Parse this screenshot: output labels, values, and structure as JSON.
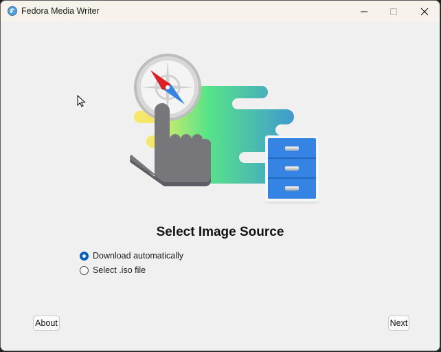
{
  "window": {
    "title": "Fedora Media Writer",
    "app_icon": "fedora-logo-icon",
    "controls": {
      "minimize": "minimize-icon",
      "maximize": "maximize-icon",
      "close": "close-icon"
    }
  },
  "main": {
    "heading": "Select Image Source",
    "illustration": "pointing-hand-compass-file-cabinet-illustration",
    "options": [
      {
        "label": "Download automatically",
        "selected": true
      },
      {
        "label": "Select .iso file",
        "selected": false
      }
    ]
  },
  "footer": {
    "about_label": "About",
    "next_label": "Next"
  },
  "colors": {
    "accent": "#0060c0",
    "titlebar_bg": "#f7f2ea",
    "window_bg": "#f0f0f0",
    "cabinet_blue": "#3584e4",
    "compass_red": "#e01b24",
    "hand_gray": "#77767b"
  }
}
